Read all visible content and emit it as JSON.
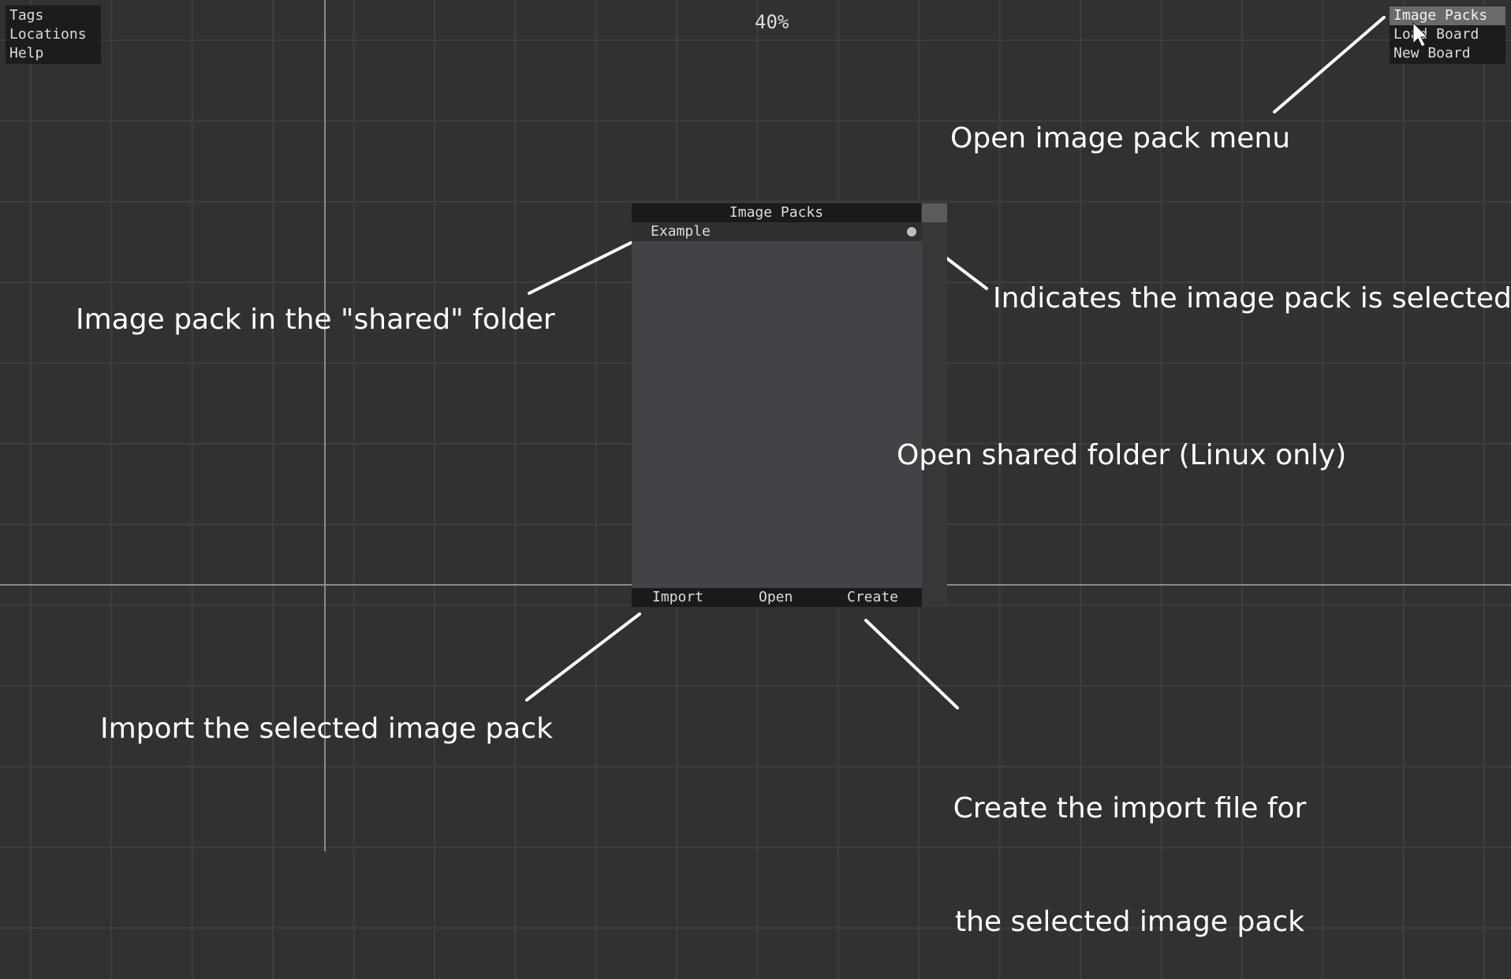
{
  "left_menu": {
    "items": [
      "Tags",
      "Locations",
      "Help"
    ]
  },
  "right_menu": {
    "items": [
      "Image Packs",
      "Load Board",
      "New Board"
    ],
    "active": "Image Packs"
  },
  "zoom": "40%",
  "window": {
    "title": "Image Packs",
    "packs": [
      {
        "name": "Example",
        "selected": true
      }
    ],
    "buttons": {
      "import": "Import",
      "open": "Open",
      "create": "Create"
    }
  },
  "annotations": {
    "open_menu": "Open image pack menu",
    "shared_folder_pack": "Image pack in the \"shared\" folder",
    "selected_indicator": "Indicates the image pack is selected",
    "open_shared": "Open shared folder (Linux only)",
    "import_pack": "Import the selected image pack",
    "create_import_line1": "Create the import file for",
    "create_import_line2": "the selected image pack"
  },
  "colors": {
    "background": "#313131",
    "grid": "#3e3e3e",
    "panel": "#434347",
    "bar": "#1a1a1a",
    "annotation": "#ffffff"
  }
}
